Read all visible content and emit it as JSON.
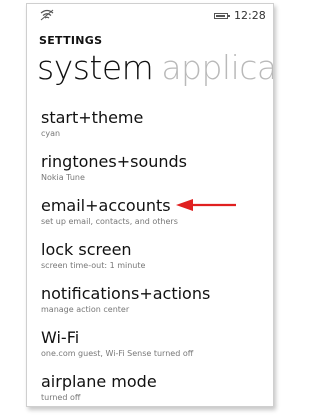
{
  "status_bar": {
    "signal_icon": "wifi-signal-icon",
    "battery_icon": "battery-icon",
    "time": "12:28"
  },
  "header": {
    "section_label": "SETTINGS",
    "pivot_active": "system",
    "pivot_next": "applicat"
  },
  "items": [
    {
      "title": "start+theme",
      "subtitle": "cyan"
    },
    {
      "title": "ringtones+sounds",
      "subtitle": "Nokia Tune"
    },
    {
      "title": "email+accounts",
      "subtitle": "set up email, contacts, and others"
    },
    {
      "title": "lock screen",
      "subtitle": "screen time-out: 1 minute"
    },
    {
      "title": "notifications+actions",
      "subtitle": "manage action center"
    },
    {
      "title": "Wi-Fi",
      "subtitle": "one.com guest, Wi-Fi Sense turned off"
    },
    {
      "title": "airplane mode",
      "subtitle": "turned off"
    }
  ],
  "annotation": {
    "icon": "red-arrow-icon",
    "color": "#e02020",
    "points_to": "email+accounts"
  }
}
